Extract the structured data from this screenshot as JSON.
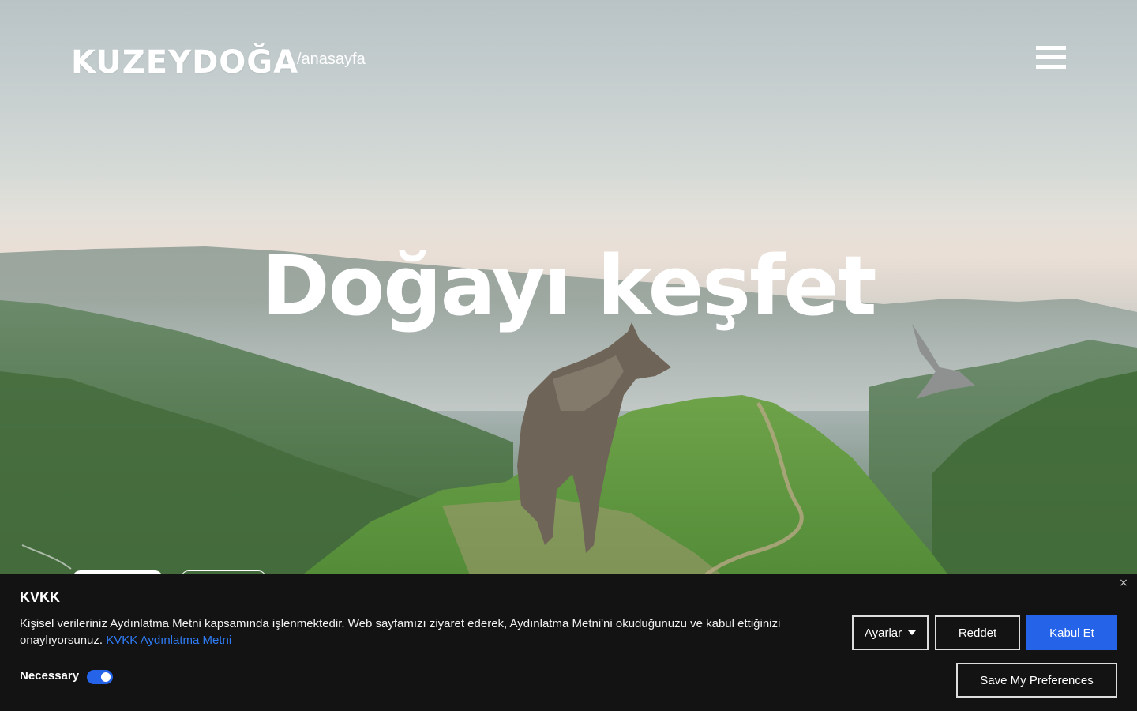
{
  "header": {
    "logo": "KUZEYDOĞA",
    "breadcrumb": "/anasayfa"
  },
  "hero": {
    "title": "Doğayı keşfet"
  },
  "cookie_banner": {
    "title": "KVKK",
    "text": "Kişisel verileriniz Aydınlatma Metni kapsamında işlenmektedir. Web sayfamızı ziyaret ederek, Aydınlatma Metni'ni okuduğunuzu ve kabul ettiğinizi onaylıyorsunuz.",
    "link": "KVKK Aydınlatma Metni",
    "necessary_label": "Necessary",
    "necessary_enabled": true,
    "close_icon": "×",
    "buttons": {
      "settings": "Ayarlar",
      "reject": "Reddet",
      "accept": "Kabul Et",
      "save": "Save My Preferences"
    }
  },
  "colors": {
    "accent": "#2563e8",
    "banner_bg": "#131313"
  }
}
